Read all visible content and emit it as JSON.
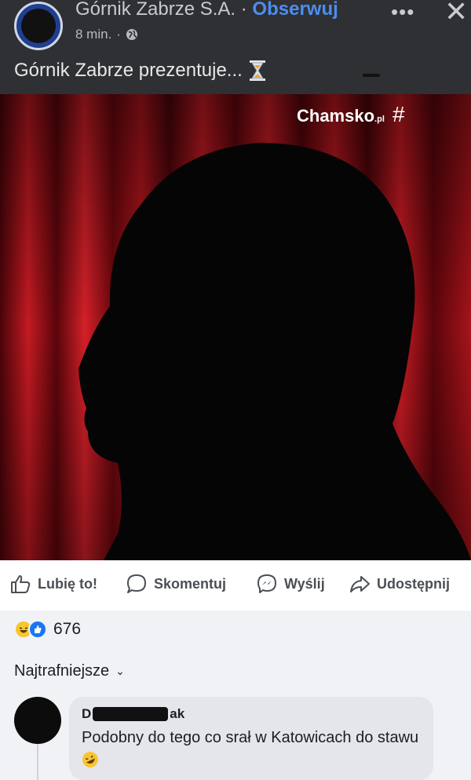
{
  "header": {
    "page_name": "Górnik Zabrze S.A.",
    "separator": "·",
    "follow_label": "Obserwuj",
    "time": "8 min.",
    "time_separator": "·",
    "post_text": "Górnik Zabrze prezentuje..."
  },
  "image": {
    "watermark": "Chamsko",
    "watermark_suffix": ".pl"
  },
  "actions": {
    "like": "Lubię to!",
    "comment": "Skomentuj",
    "send": "Wyślij",
    "share": "Udostępnij"
  },
  "reactions": {
    "count": "676"
  },
  "comments": {
    "sort_label": "Najtrafniejsze",
    "items": [
      {
        "author_start": "D",
        "author_end": "ak",
        "text": "Podobny do tego co srał w Katowicach do stawu"
      }
    ]
  },
  "colors": {
    "accent": "#4b8df0",
    "header_bg": "#2f3033",
    "curtain_red": "#c41a22"
  }
}
